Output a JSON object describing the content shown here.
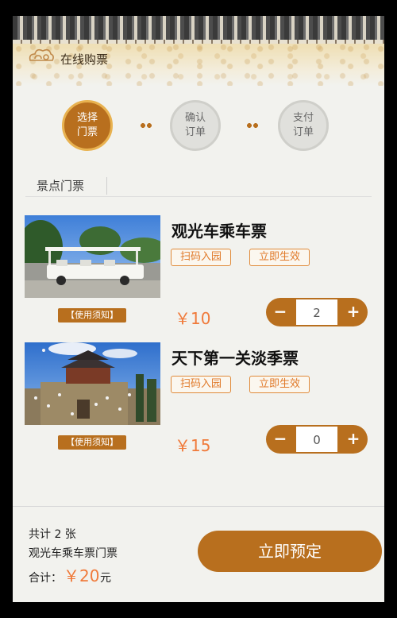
{
  "header": {
    "title": "在线购票"
  },
  "steps": [
    {
      "label_line1": "选择",
      "label_line2": "门票"
    },
    {
      "label_line1": "确认",
      "label_line2": "订单"
    },
    {
      "label_line1": "支付",
      "label_line2": "订单"
    }
  ],
  "section": {
    "label": "景点门票"
  },
  "tickets": [
    {
      "name": "观光车乘车票",
      "tags": [
        "扫码入园",
        "立即生效"
      ],
      "notice": "【使用须知】",
      "price": "￥10",
      "quantity": "2",
      "minus": "−",
      "plus": "+"
    },
    {
      "name": "天下第一关淡季票",
      "tags": [
        "扫码入园",
        "立即生效"
      ],
      "notice": "【使用须知】",
      "price": "￥15",
      "quantity": "0",
      "minus": "−",
      "plus": "+"
    }
  ],
  "summary": {
    "count": "共计 2 张",
    "item": "观光车乘车票门票",
    "total_label": "合计：",
    "total_value": "￥20",
    "total_unit": "元"
  },
  "actions": {
    "book_label": "立即预定"
  },
  "colors": {
    "accent": "#b86f1e",
    "price": "#f07a3a",
    "tag": "#e07a2a"
  }
}
